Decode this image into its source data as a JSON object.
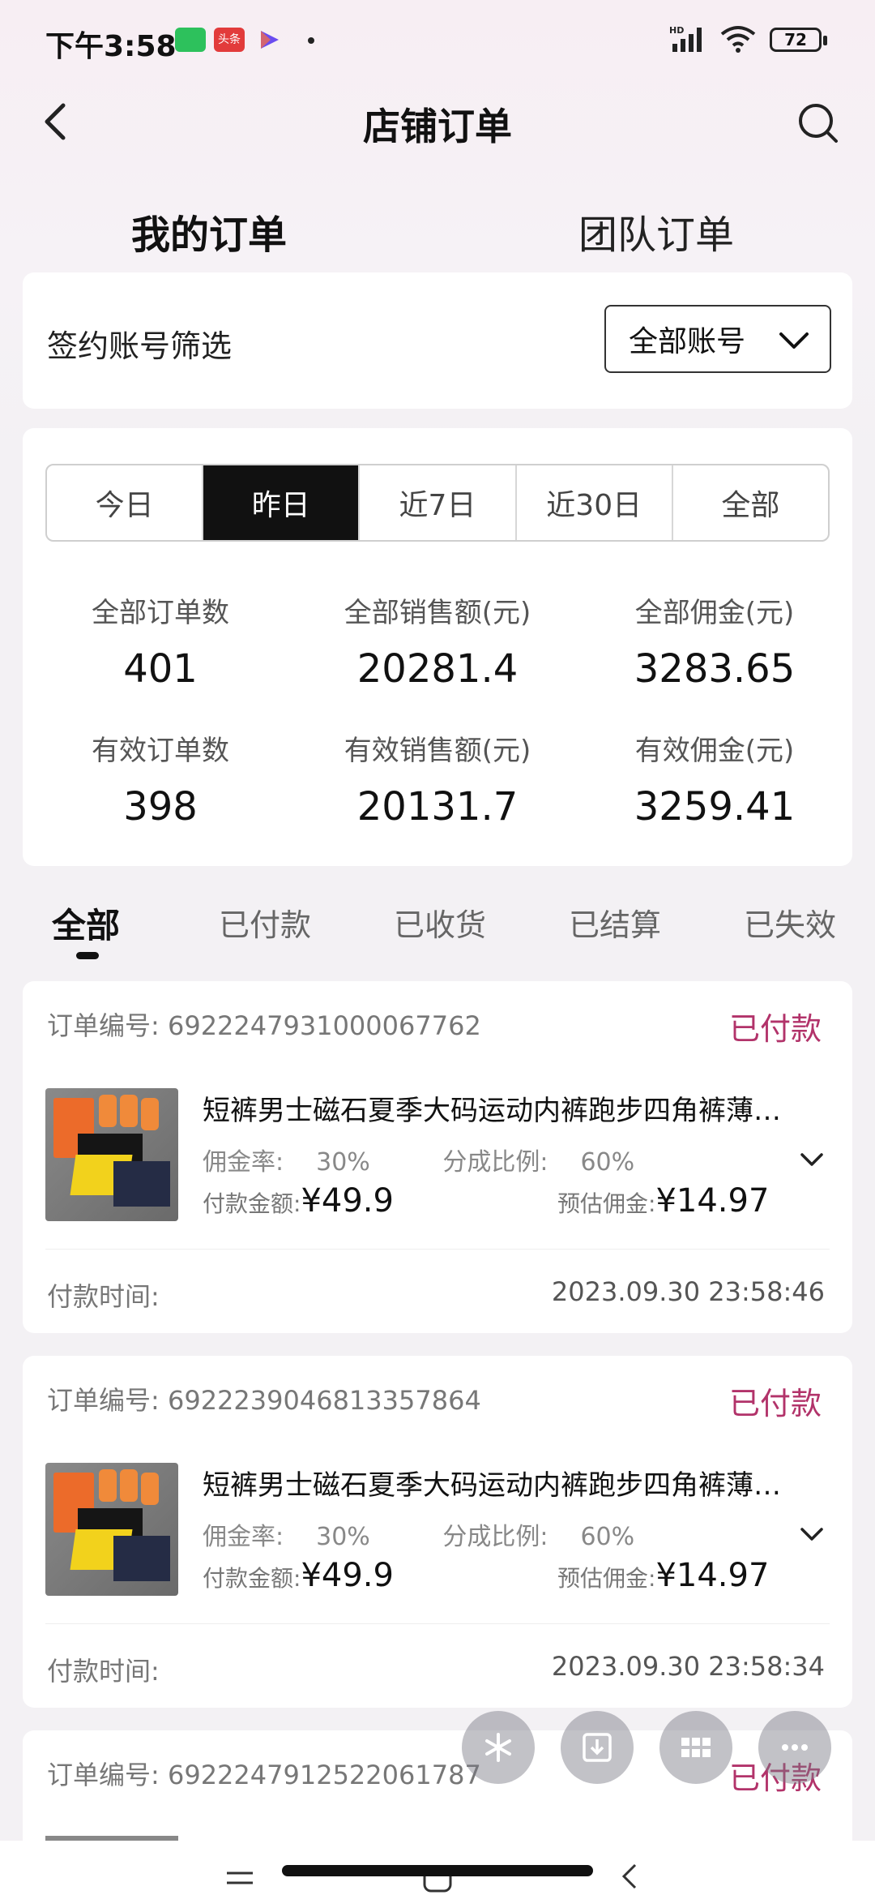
{
  "status_bar": {
    "time": "下午3:58",
    "toutiao_label": "头条",
    "battery": "72"
  },
  "header": {
    "title": "店铺订单"
  },
  "main_tabs": [
    {
      "label": "我的订单"
    },
    {
      "label": "团队订单"
    }
  ],
  "filter": {
    "label": "签约账号筛选",
    "selected_value": "全部账号"
  },
  "date_range": {
    "options": [
      "今日",
      "昨日",
      "近7日",
      "近30日",
      "全部"
    ],
    "selected": "昨日"
  },
  "stats": [
    {
      "label": "全部订单数",
      "value": "401"
    },
    {
      "label": "全部销售额(元)",
      "value": "20281.4"
    },
    {
      "label": "全部佣金(元)",
      "value": "3283.65"
    },
    {
      "label": "有效订单数",
      "value": "398"
    },
    {
      "label": "有效销售额(元)",
      "value": "20131.7"
    },
    {
      "label": "有效佣金(元)",
      "value": "3259.41"
    }
  ],
  "status_tabs": [
    "全部",
    "已付款",
    "已收货",
    "已结算",
    "已失效"
  ],
  "orders": [
    {
      "order_no_label": "订单编号:",
      "order_no": "6922247931000067762",
      "status": "已付款",
      "title": "短裤男士磁石夏季大码运动内裤跑步四角裤薄…",
      "commission_rate_label": "佣金率:",
      "commission_rate": "30%",
      "split_label": "分成比例:",
      "split": "60%",
      "paid_label": "付款金额:",
      "paid": "¥49.9",
      "est_label": "预估佣金:",
      "est": "¥14.97",
      "pay_time_label": "付款时间:",
      "pay_time": "2023.09.30 23:58:46"
    },
    {
      "order_no_label": "订单编号:",
      "order_no": "6922239046813357864",
      "status": "已付款",
      "title": "短裤男士磁石夏季大码运动内裤跑步四角裤薄…",
      "commission_rate_label": "佣金率:",
      "commission_rate": "30%",
      "split_label": "分成比例:",
      "split": "60%",
      "paid_label": "付款金额:",
      "paid": "¥49.9",
      "est_label": "预估佣金:",
      "est": "¥14.97",
      "pay_time_label": "付款时间:",
      "pay_time": "2023.09.30 23:58:34"
    },
    {
      "order_no_label": "订单编号:",
      "order_no": "6922247912522061787",
      "status": "已付款"
    }
  ],
  "floating_buttons": [
    "sparkle-icon",
    "download-icon",
    "grid-icon",
    "more-icon"
  ]
}
